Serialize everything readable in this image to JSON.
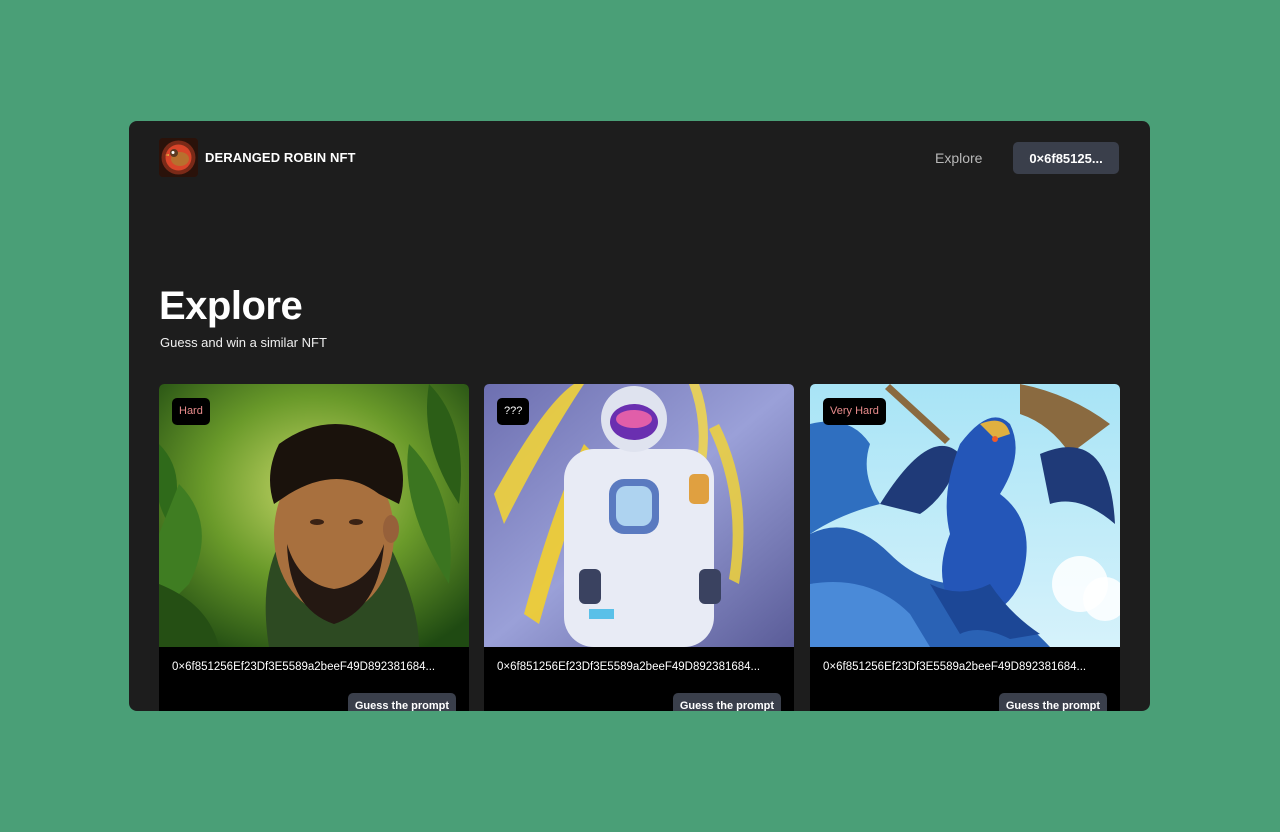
{
  "brand": {
    "name": "DERANGED ROBIN NFT",
    "logo_icon": "robin-logo-icon"
  },
  "nav": {
    "explore_label": "Explore",
    "wallet_label": "0×6f85125..."
  },
  "page": {
    "title": "Explore",
    "subtitle": "Guess and win a similar NFT"
  },
  "cards": [
    {
      "difficulty": "Hard",
      "image": "portrait-jungle-art",
      "address": "0×6f851256Ef23Df3E5589a2beeF49D892381684...",
      "action_label": "Guess the prompt"
    },
    {
      "difficulty": "???",
      "image": "astronaut-art",
      "address": "0×6f851256Ef23Df3E5589a2beeF49D892381684...",
      "action_label": "Guess the prompt"
    },
    {
      "difficulty": "Very Hard",
      "image": "blue-dragon-art",
      "address": "0×6f851256Ef23Df3E5589a2beeF49D892381684...",
      "action_label": "Guess the prompt"
    }
  ],
  "colors": {
    "background": "#4a9f77",
    "window": "#1d1d1d",
    "button": "#3a3f4b",
    "badge_hard_text": "#e98c8c"
  }
}
